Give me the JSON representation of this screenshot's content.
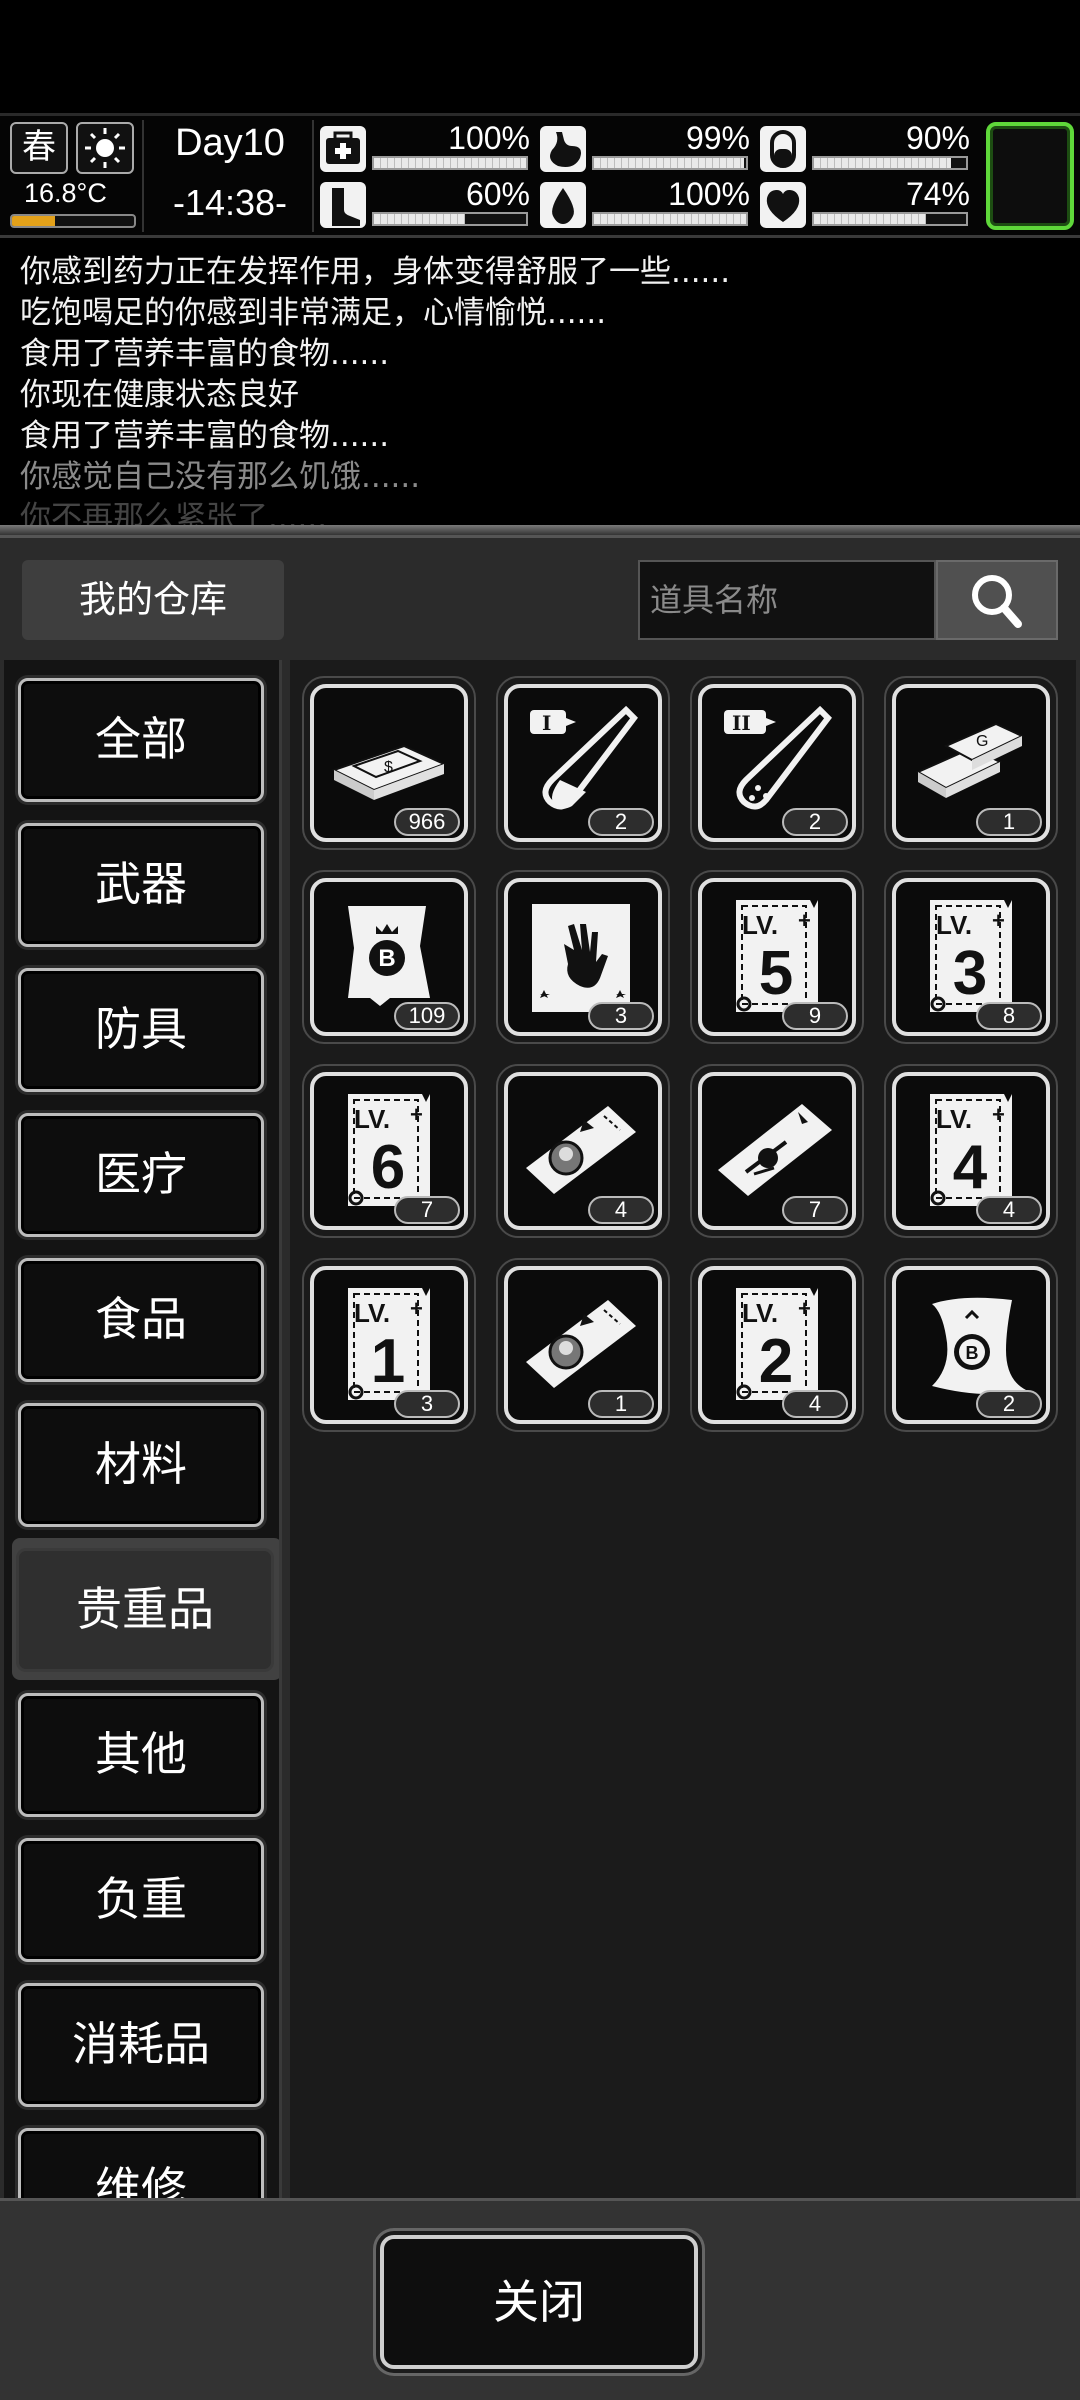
{
  "hud": {
    "season": "春",
    "weather_icon": "sun-icon",
    "temperature": "16.8°C",
    "temperature_level": 0.35,
    "day": "Day10",
    "time": "-14:38-",
    "stats": [
      {
        "name": "health",
        "icon": "medkit-icon",
        "value": "100%",
        "level": 1.0
      },
      {
        "name": "hunger",
        "icon": "stomach-icon",
        "value": "99%",
        "level": 0.99
      },
      {
        "name": "medicine",
        "icon": "pill-icon",
        "value": "90%",
        "level": 0.9
      },
      {
        "name": "stamina",
        "icon": "boot-icon",
        "value": "60%",
        "level": 0.6
      },
      {
        "name": "thirst",
        "icon": "water-drop-icon",
        "value": "100%",
        "level": 1.0
      },
      {
        "name": "mood",
        "icon": "heart-icon",
        "value": "74%",
        "level": 0.74
      }
    ]
  },
  "log": [
    "你感到药力正在发挥作用，身体变得舒服了一些......",
    "吃饱喝足的你感到非常满足，心情愉悦......",
    "食用了营养丰富的食物......",
    "你现在健康状态良好",
    "食用了营养丰富的食物......",
    "你感觉自己没有那么饥饿......",
    "你不再那么紧张了......"
  ],
  "warehouse": {
    "title": "我的仓库",
    "search_placeholder": "道具名称",
    "categories": [
      "全部",
      "武器",
      "防具",
      "医疗",
      "食品",
      "材料",
      "贵重品",
      "其他",
      "负重",
      "消耗品",
      "维修"
    ],
    "active_category": "贵重品",
    "items": [
      {
        "icon": "cash-stack-icon",
        "count": "966"
      },
      {
        "icon": "test-tube-1-icon",
        "count": "2"
      },
      {
        "icon": "test-tube-2-icon",
        "count": "2"
      },
      {
        "icon": "gold-bars-icon",
        "count": "1"
      },
      {
        "icon": "bitcoin-badge-icon",
        "count": "109"
      },
      {
        "icon": "zombie-hand-card-icon",
        "count": "3"
      },
      {
        "icon": "level-ticket-icon",
        "level": "5",
        "lv": "LV.",
        "count": "9"
      },
      {
        "icon": "level-ticket-icon",
        "level": "3",
        "lv": "LV.",
        "count": "8"
      },
      {
        "icon": "level-ticket-icon",
        "level": "6",
        "lv": "LV.",
        "count": "7"
      },
      {
        "icon": "portrait-ticket-icon",
        "count": "4"
      },
      {
        "icon": "helicopter-ticket-icon",
        "count": "7"
      },
      {
        "icon": "level-ticket-icon",
        "level": "4",
        "lv": "LV.",
        "count": "4"
      },
      {
        "icon": "level-ticket-icon",
        "level": "1",
        "lv": "LV.",
        "count": "3"
      },
      {
        "icon": "portrait-ticket-icon",
        "count": "1"
      },
      {
        "icon": "level-ticket-icon",
        "level": "2",
        "lv": "LV.",
        "count": "4"
      },
      {
        "icon": "bitcoin-scroll-icon",
        "count": "2"
      }
    ],
    "close_label": "关闭"
  }
}
